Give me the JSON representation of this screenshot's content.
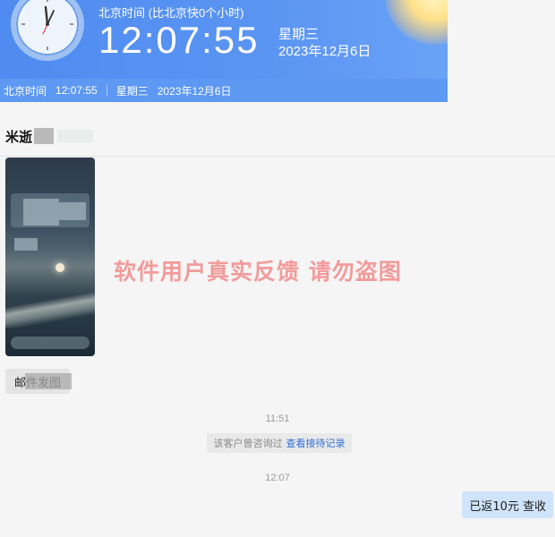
{
  "clock": {
    "caption": "北京时间 (比北京快0个小时)",
    "time": "12:07:55",
    "weekday": "星期三",
    "date": "2023年12月6日",
    "strip_label": "北京时间",
    "strip_time": "12:07:55",
    "strip_weekday": "星期三",
    "strip_date": "2023年12月6日"
  },
  "chat": {
    "contact_name": "米逝",
    "watermark": "软件用户真实反馈 请勿盗图",
    "left_message": "邮件发图",
    "time_1": "11:51",
    "notice_text": "该客户曾咨询过",
    "notice_link": "查看接待记录",
    "time_2": "12:07",
    "right_message": "已返10元 查收"
  },
  "colors": {
    "clock_blue": "#4f8bf0",
    "watermark": "#f29b9b",
    "link": "#2f6fd6",
    "outgoing_bubble": "#cfe4fb"
  }
}
